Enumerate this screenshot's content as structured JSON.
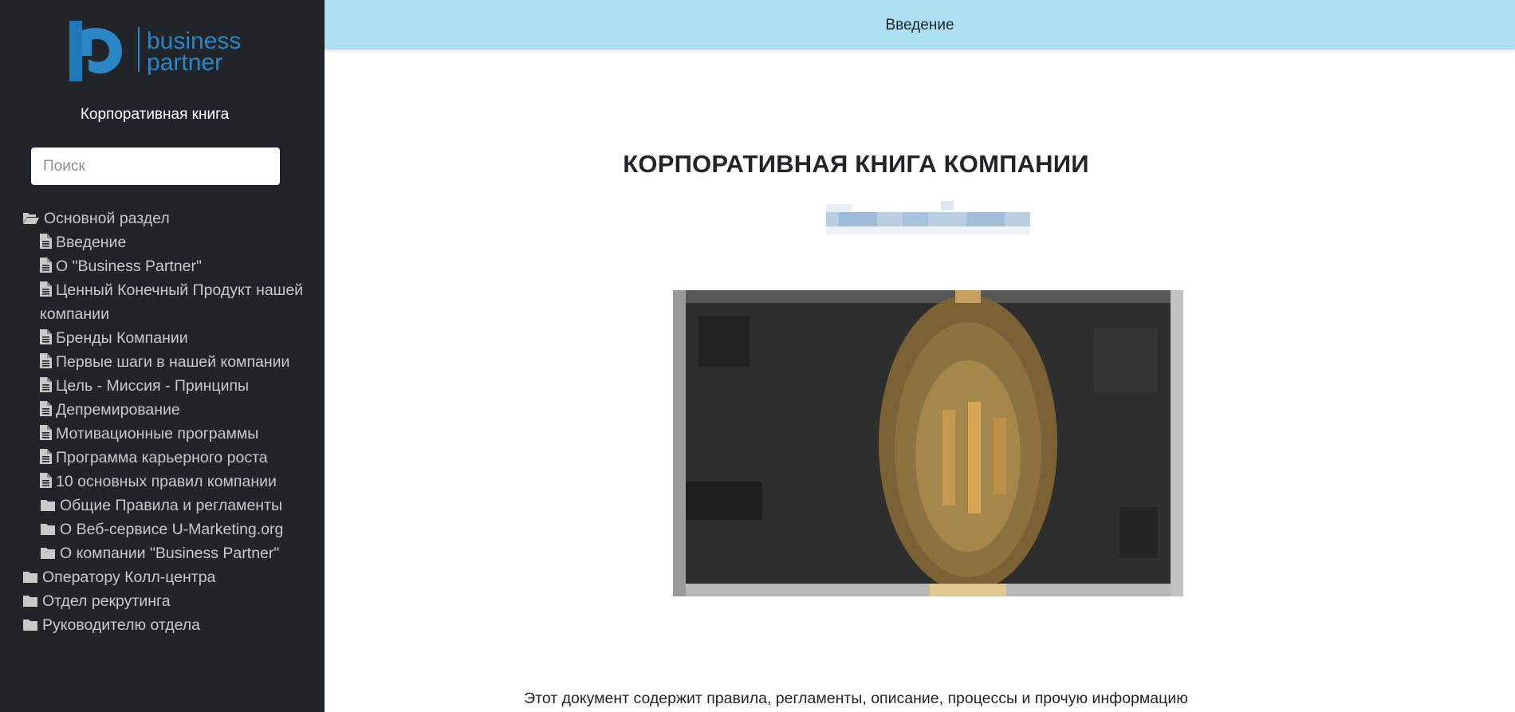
{
  "brand": {
    "logo_line1": "business",
    "logo_line2": "partner",
    "title": "Корпоративная книга"
  },
  "search": {
    "placeholder": "Поиск"
  },
  "tree": [
    {
      "label": "Основной раздел",
      "icon": "folder-open-icon",
      "level": 0
    },
    {
      "label": "Введение",
      "icon": "document-icon",
      "level": 1
    },
    {
      "label": "О \"Business Partner\"",
      "icon": "document-icon",
      "level": 1
    },
    {
      "label": "Ценный Конечный Продукт нашей компании",
      "icon": "document-icon",
      "level": 1
    },
    {
      "label": "Бренды Компании",
      "icon": "document-icon",
      "level": 1
    },
    {
      "label": "Первые шаги в нашей компании",
      "icon": "document-icon",
      "level": 1
    },
    {
      "label": "Цель - Миссия - Принципы",
      "icon": "document-icon",
      "level": 1
    },
    {
      "label": "Депремирование",
      "icon": "document-icon",
      "level": 1
    },
    {
      "label": "Мотивационные программы",
      "icon": "document-icon",
      "level": 1
    },
    {
      "label": "Программа карьерного роста",
      "icon": "document-icon",
      "level": 1
    },
    {
      "label": "10 основных правил компании",
      "icon": "document-icon",
      "level": 1
    },
    {
      "label": "Общие Правила и регламенты",
      "icon": "folder-icon",
      "level": 1
    },
    {
      "label": "О Веб-сервисе U-Marketing.org",
      "icon": "folder-icon",
      "level": 1
    },
    {
      "label": "О компании \"Business Partner\"",
      "icon": "folder-icon",
      "level": 1
    },
    {
      "label": "Оператору Колл-центра",
      "icon": "folder-icon",
      "level": 0
    },
    {
      "label": "Отдел рекрутинга",
      "icon": "folder-icon",
      "level": 0
    },
    {
      "label": "Руководителю отдела",
      "icon": "folder-icon",
      "level": 0
    }
  ],
  "topbar": {
    "title": "Введение"
  },
  "main": {
    "title": "КОРПОРАТИВНАЯ КНИГА КОМПАНИИ",
    "text": "Этот документ содержит правила, регламенты, описание, процессы и прочую информацию"
  },
  "colors": {
    "sidebar_bg": "#212529",
    "topbar_bg": "#addff3",
    "accent": "#2a86c4"
  }
}
